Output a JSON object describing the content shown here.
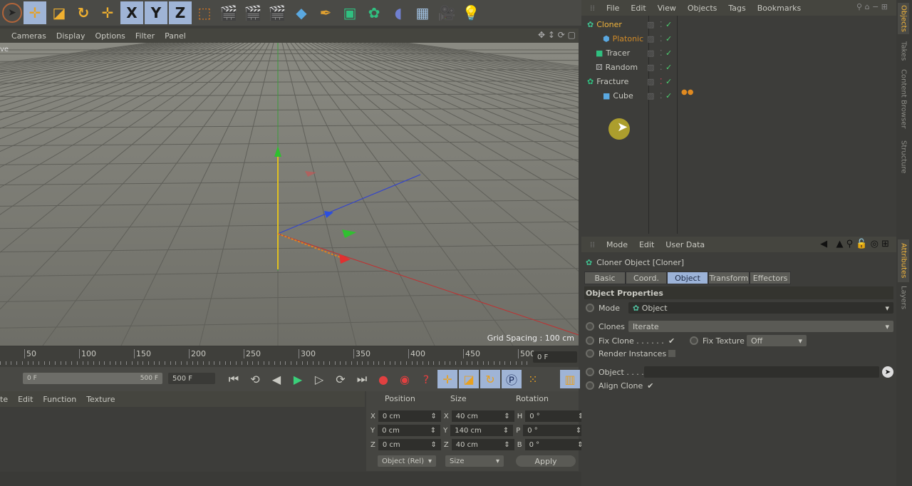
{
  "toolbar": {
    "icons": [
      "live-selection-icon",
      "move-icon",
      "scale-icon",
      "rotate-icon",
      "move-icon",
      "x-axis-lock-icon",
      "y-axis-lock-icon",
      "z-axis-lock-icon",
      "coordinate-system-icon",
      "render-view-icon",
      "render-picture-viewer-icon",
      "render-settings-icon",
      "cube-primitive-icon",
      "pen-spline-icon",
      "subdivision-icon",
      "mograph-cloner-icon",
      "deformer-icon",
      "floor-icon",
      "camera-icon",
      "light-icon"
    ],
    "axis_labels": [
      "X",
      "Y",
      "Z"
    ]
  },
  "viewport": {
    "menu": [
      "Cameras",
      "Display",
      "Options",
      "Filter",
      "Panel"
    ],
    "view_name": "ve",
    "grid_spacing": "Grid Spacing : 100 cm"
  },
  "timeline": {
    "ticks": [
      "50",
      "100",
      "150",
      "200",
      "250",
      "300",
      "350",
      "400",
      "450",
      "500"
    ],
    "current_frame": "0 F",
    "range_start": "0 F",
    "range_end": "500 F",
    "end_frame": "500 F"
  },
  "material_menu": [
    "te",
    "Edit",
    "Function",
    "Texture"
  ],
  "coords": {
    "headers": [
      "Position",
      "Size",
      "Rotation"
    ],
    "rows": [
      {
        "a": "X",
        "pos": "0 cm",
        "s": "X",
        "size": "40 cm",
        "r": "H",
        "rot": "0 °"
      },
      {
        "a": "Y",
        "pos": "0 cm",
        "s": "Y",
        "size": "140 cm",
        "r": "P",
        "rot": "0 °"
      },
      {
        "a": "Z",
        "pos": "0 cm",
        "s": "Z",
        "size": "40 cm",
        "r": "B",
        "rot": "0 °"
      }
    ],
    "mode": "Object (Rel)",
    "size_mode": "Size",
    "apply": "Apply"
  },
  "objects": {
    "menu": [
      "File",
      "Edit",
      "View",
      "Objects",
      "Tags",
      "Bookmarks"
    ],
    "items": [
      {
        "name": "Cloner",
        "color": "#f0b43c"
      },
      {
        "name": "Platonic",
        "color": "#d08a28"
      },
      {
        "name": "Tracer",
        "color": "#c9c9c2"
      },
      {
        "name": "Random",
        "color": "#c9c9c2"
      },
      {
        "name": "Fracture",
        "color": "#c9c9c2"
      },
      {
        "name": "Cube",
        "color": "#c9c9c2"
      }
    ]
  },
  "side_tabs_top": [
    "Objects",
    "Takes",
    "Content Browser",
    "Structure"
  ],
  "side_tabs_bottom": [
    "Attributes",
    "Layers"
  ],
  "attributes": {
    "menu": [
      "Mode",
      "Edit",
      "User Data"
    ],
    "title": "Cloner Object [Cloner]",
    "tabs": [
      "Basic",
      "Coord.",
      "Object",
      "Transform",
      "Effectors"
    ],
    "active_tab": "Object",
    "section": "Object Properties",
    "mode_label": "Mode",
    "mode_value": "Object",
    "clones_label": "Clones",
    "clones_value": "Iterate",
    "fix_clone_label": "Fix Clone . . . . . .",
    "fix_clone": true,
    "fix_texture_label": "Fix Texture",
    "fix_texture_value": "Off",
    "render_instances_label": "Render Instances",
    "render_instances": false,
    "object_label": "Object . . . .",
    "object_value": "",
    "align_clone_label": "Align Clone",
    "align_clone": true
  }
}
